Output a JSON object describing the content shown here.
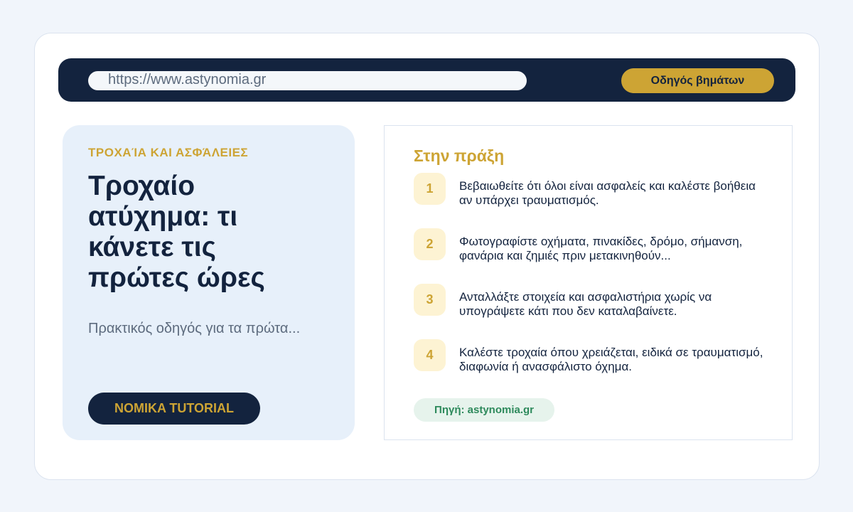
{
  "browser": {
    "url": "https://www.astynomia.gr",
    "guide_button": "Οδηγός βημάτων"
  },
  "hero": {
    "kicker": "ΤΡΟΧΑΊΑ ΚΑΙ ΑΣΦΆΛΕΙΕΣ",
    "title": "Τροχαίο ατύχημα: τι κάνετε τις πρώτες ώρες",
    "subtitle": "Πρακτικός οδηγός για τα πρώτα...",
    "button": "NOMIKA TUTORIAL"
  },
  "practice": {
    "title": "Στην πράξη",
    "steps": [
      {
        "number": "1",
        "text": "Βεβαιωθείτε ότι όλοι είναι ασφαλείς και καλέστε βοήθεια αν υπάρχει τραυματισμός."
      },
      {
        "number": "2",
        "text": "Φωτογραφίστε οχήματα, πινακίδες, δρόμο, σήμανση, φανάρια και ζημιές πριν μετακινηθούν..."
      },
      {
        "number": "3",
        "text": "Ανταλλάξτε στοιχεία και ασφαλιστήρια χωρίς να υπογράψετε κάτι που δεν καταλαβαίνετε."
      },
      {
        "number": "4",
        "text": "Καλέστε τροχαία όπου χρειάζεται, ειδικά σε τραυματισμό, διαφωνία ή ανασφάλιστο όχημα."
      }
    ],
    "source": "Πηγή: astynomia.gr"
  },
  "colors": {
    "navy": "#13233e",
    "gold": "#cda434",
    "hero_bg": "#e7f0fa",
    "step_bg": "#fdf3d3",
    "source_green": "#2e8a5c",
    "source_bg": "#e6f3ec"
  }
}
